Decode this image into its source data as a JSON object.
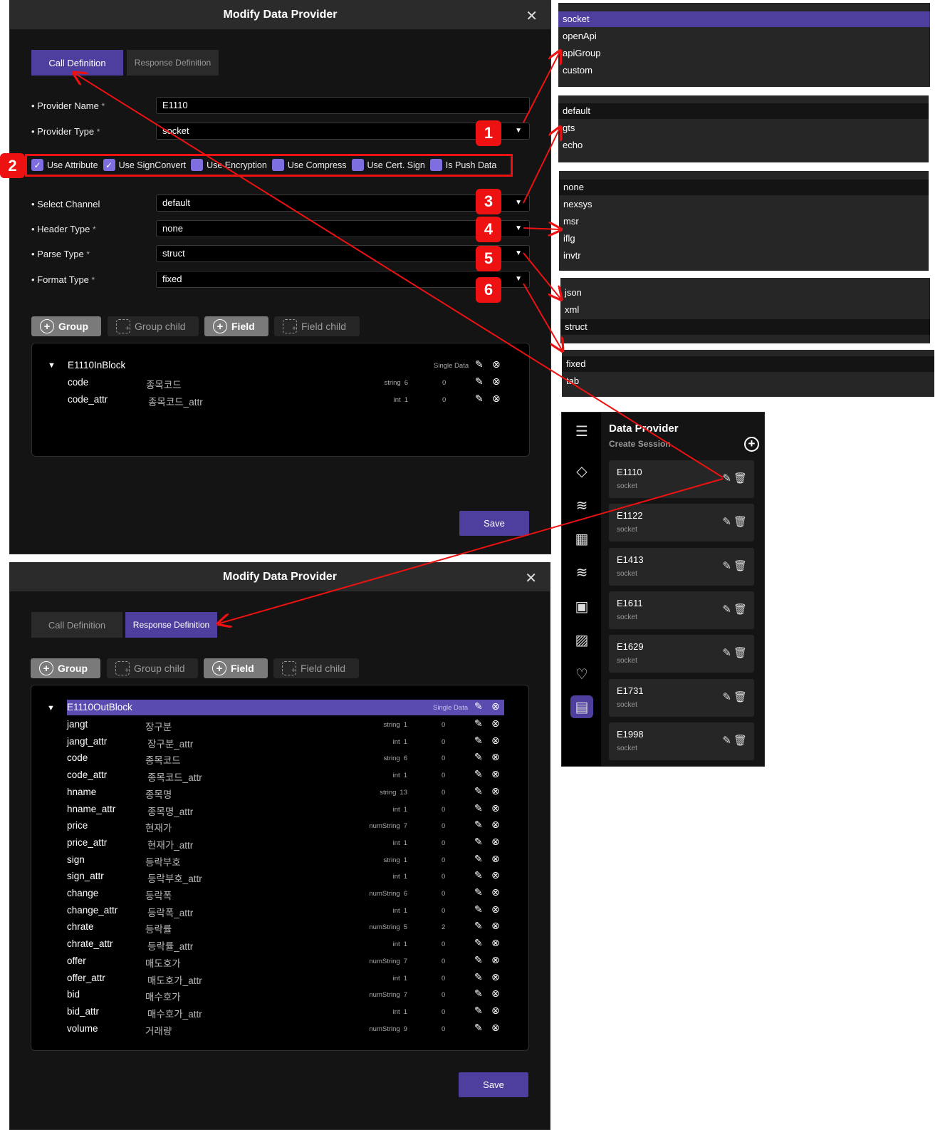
{
  "modal_top": {
    "title": "Modify Data Provider",
    "close": "✕",
    "tabs": [
      "Call Definition",
      "Response Definition"
    ],
    "fields": {
      "provider_name_label": "Provider Name",
      "provider_name_value": "E1110",
      "provider_type_label": "Provider Type",
      "provider_type_value": "socket",
      "select_channel_label": "Select Channel",
      "select_channel_value": "default",
      "header_type_label": "Header Type",
      "header_type_value": "none",
      "parse_type_label": "Parse Type",
      "parse_type_value": "struct",
      "format_type_label": "Format Type",
      "format_type_value": "fixed",
      "required_mark": "*"
    },
    "checkboxes": [
      {
        "label": "Use Attribute",
        "checked": true
      },
      {
        "label": "Use SignConvert",
        "checked": true
      },
      {
        "label": "Use Encryption",
        "checked": false
      },
      {
        "label": "Use Compress",
        "checked": false
      },
      {
        "label": "Use Cert. Sign",
        "checked": false
      },
      {
        "label": "Is Push Data",
        "checked": false
      }
    ],
    "toolbar": {
      "group": "Group",
      "group_child": "Group child",
      "field": "Field",
      "field_child": "Field child"
    },
    "tree": {
      "block": "E1110InBlock",
      "block_type": "Single Data",
      "rows": [
        {
          "name": "code",
          "kor": "종목코드",
          "type": "string",
          "len": "6",
          "dec": "0"
        },
        {
          "name": "code_attr",
          "kor": "종목코드_attr",
          "type": "int",
          "len": "1",
          "dec": "0"
        }
      ]
    },
    "save": "Save"
  },
  "modal_bottom": {
    "title": "Modify Data Provider",
    "close": "✕",
    "tabs": [
      "Call Definition",
      "Response Definition"
    ],
    "toolbar": {
      "group": "Group",
      "group_child": "Group child",
      "field": "Field",
      "field_child": "Field child"
    },
    "tree": {
      "block": "E1110OutBlock",
      "block_type": "Single Data",
      "rows": [
        {
          "name": "jangt",
          "kor": "장구분",
          "type": "string",
          "len": "1",
          "dec": "0"
        },
        {
          "name": "jangt_attr",
          "kor": "장구분_attr",
          "type": "int",
          "len": "1",
          "dec": "0"
        },
        {
          "name": "code",
          "kor": "종목코드",
          "type": "string",
          "len": "6",
          "dec": "0"
        },
        {
          "name": "code_attr",
          "kor": "종목코드_attr",
          "type": "int",
          "len": "1",
          "dec": "0"
        },
        {
          "name": "hname",
          "kor": "종목명",
          "type": "string",
          "len": "13",
          "dec": "0"
        },
        {
          "name": "hname_attr",
          "kor": "종목명_attr",
          "type": "int",
          "len": "1",
          "dec": "0"
        },
        {
          "name": "price",
          "kor": "현재가",
          "type": "numString",
          "len": "7",
          "dec": "0"
        },
        {
          "name": "price_attr",
          "kor": "현재가_attr",
          "type": "int",
          "len": "1",
          "dec": "0"
        },
        {
          "name": "sign",
          "kor": "등락부호",
          "type": "string",
          "len": "1",
          "dec": "0"
        },
        {
          "name": "sign_attr",
          "kor": "등락부호_attr",
          "type": "int",
          "len": "1",
          "dec": "0"
        },
        {
          "name": "change",
          "kor": "등락폭",
          "type": "numString",
          "len": "6",
          "dec": "0"
        },
        {
          "name": "change_attr",
          "kor": "등락폭_attr",
          "type": "int",
          "len": "1",
          "dec": "0"
        },
        {
          "name": "chrate",
          "kor": "등락률",
          "type": "numString",
          "len": "5",
          "dec": "2"
        },
        {
          "name": "chrate_attr",
          "kor": "등락률_attr",
          "type": "int",
          "len": "1",
          "dec": "0"
        },
        {
          "name": "offer",
          "kor": "매도호가",
          "type": "numString",
          "len": "7",
          "dec": "0"
        },
        {
          "name": "offer_attr",
          "kor": "매도호가_attr",
          "type": "int",
          "len": "1",
          "dec": "0"
        },
        {
          "name": "bid",
          "kor": "매수호가",
          "type": "numString",
          "len": "7",
          "dec": "0"
        },
        {
          "name": "bid_attr",
          "kor": "매수호가_attr",
          "type": "int",
          "len": "1",
          "dec": "0"
        },
        {
          "name": "volume",
          "kor": "거래량",
          "type": "numString",
          "len": "9",
          "dec": "0"
        }
      ]
    },
    "save": "Save"
  },
  "dropdowns": {
    "provider_type": {
      "options": [
        "socket",
        "openApi",
        "apiGroup",
        "custom"
      ],
      "selected": "socket"
    },
    "channel": {
      "options": [
        "default",
        "gts",
        "echo"
      ],
      "selected": "default"
    },
    "header_type": {
      "options": [
        "none",
        "nexsys",
        "msr",
        "iflg",
        "invtr"
      ],
      "selected": "none"
    },
    "parse_type": {
      "options": [
        "json",
        "xml",
        "struct"
      ],
      "selected": "struct"
    },
    "format_type": {
      "options": [
        "fixed",
        "tab"
      ],
      "selected": "fixed"
    }
  },
  "badges": [
    "1",
    "2",
    "3",
    "4",
    "5",
    "6"
  ],
  "side_panel": {
    "title": "Data Provider",
    "subtitle": "Create Session",
    "items": [
      {
        "name": "E1110",
        "type": "socket"
      },
      {
        "name": "E1122",
        "type": "socket"
      },
      {
        "name": "E1413",
        "type": "socket"
      },
      {
        "name": "E1611",
        "type": "socket"
      },
      {
        "name": "E1629",
        "type": "socket"
      },
      {
        "name": "E1731",
        "type": "socket"
      },
      {
        "name": "E1998",
        "type": "socket"
      }
    ]
  },
  "colors": {
    "accent": "#4e3f9e",
    "annotation": "#ee1111",
    "panel": "#141414",
    "input": "#000000"
  }
}
